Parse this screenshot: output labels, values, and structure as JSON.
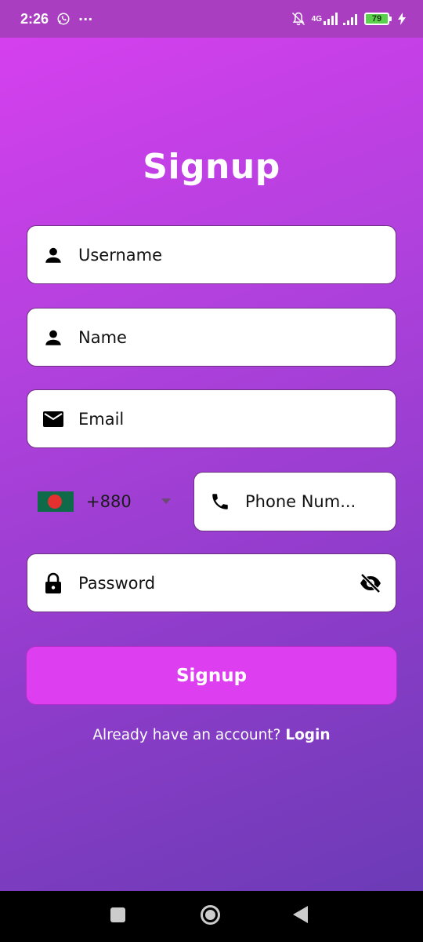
{
  "status_bar": {
    "time": "2:26",
    "overflow": "···",
    "network_label": "4G",
    "battery_level": "79",
    "icons": [
      "whatsapp-icon",
      "mute-bell-icon",
      "signal-icon",
      "signal-icon",
      "battery-icon",
      "charging-icon"
    ]
  },
  "title": "Signup",
  "fields": {
    "username": {
      "placeholder": "Username",
      "icon": "person-icon"
    },
    "name": {
      "placeholder": "Name",
      "icon": "person-icon"
    },
    "email": {
      "placeholder": "Email",
      "icon": "mail-icon"
    },
    "phone": {
      "country_code": "+880",
      "country_flag": "bangladesh-flag",
      "placeholder": "Phone Num...",
      "icon": "phone-icon"
    },
    "password": {
      "placeholder": "Password",
      "icon": "lock-icon",
      "toggle_icon": "visibility-off-icon"
    }
  },
  "signup_button": {
    "label": "Signup",
    "color": "#dd3ff0"
  },
  "login_prompt": {
    "text": "Already have an account?",
    "link": "Login"
  },
  "colors": {
    "gradient_top": "#d93ff0",
    "gradient_bottom": "#6c3bb6",
    "status_bar": "#a93ec0"
  }
}
